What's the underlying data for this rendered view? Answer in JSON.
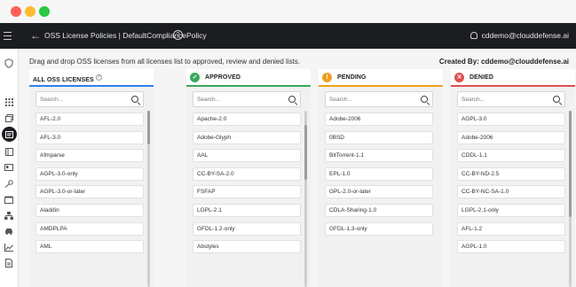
{
  "window": {
    "controls": [
      "close",
      "minimize",
      "maximize"
    ]
  },
  "topbar": {
    "title": "OSS License Policies | DefaultCompliancePolicy",
    "help_glyph": "?",
    "user": "cddemo@clouddefense.ai"
  },
  "sidebar": {
    "icons": [
      "shield-icon",
      "grid-icon",
      "stack-icon",
      "license-icon",
      "book-icon",
      "id-card-icon",
      "key-icon",
      "box-icon",
      "network-icon",
      "car-icon",
      "chart-icon",
      "document-icon"
    ],
    "active": "license-icon"
  },
  "main": {
    "instructions": "Drag and drop OSS licenses from all licenses list to approved, review and denied lists.",
    "created_by_label": "Created By:",
    "created_by_value": "cddemo@clouddefense.ai"
  },
  "columns": [
    {
      "title": "ALL OSS LICENSES",
      "accent": "#2f80ed",
      "search_placeholder": "Search...",
      "items": [
        "AFL-2.0",
        "AFL-3.0",
        "Afmparse",
        "AGPL-3.0-only",
        "AGPL-3.0-or-later",
        "Aladdin",
        "AMDPLPA",
        "AML"
      ]
    },
    {
      "title": "APPROVED",
      "accent": "#3aaa5b",
      "search_placeholder": "Search...",
      "items": [
        "Apache-2.0",
        "Adobe-Glyph",
        "AAL",
        "CC-BY-SA-2.0",
        "FSFAP",
        "LGPL-2.1",
        "GFDL-1.2-only",
        "Abstyles"
      ]
    },
    {
      "title": "PENDING",
      "accent": "#f0a020",
      "search_placeholder": "Search...",
      "items": [
        "Adobe-2006",
        "0BSD",
        "BitTorrent-1.1",
        "EPL-1.0",
        "GPL-2.0-or-later",
        "CDLA-Sharing-1.0",
        "GFDL-1.3-only"
      ]
    },
    {
      "title": "DENIED",
      "accent": "#e05050",
      "search_placeholder": "Search...",
      "items": [
        "AGPL-3.0",
        "Adobe-2006",
        "CDDL-1.1",
        "CC-BY-ND-2.5",
        "CC-BY-NC-SA-1.0",
        "LGPL-2.1-only",
        "AFL-1.2",
        "AGPL-1.0"
      ]
    }
  ]
}
